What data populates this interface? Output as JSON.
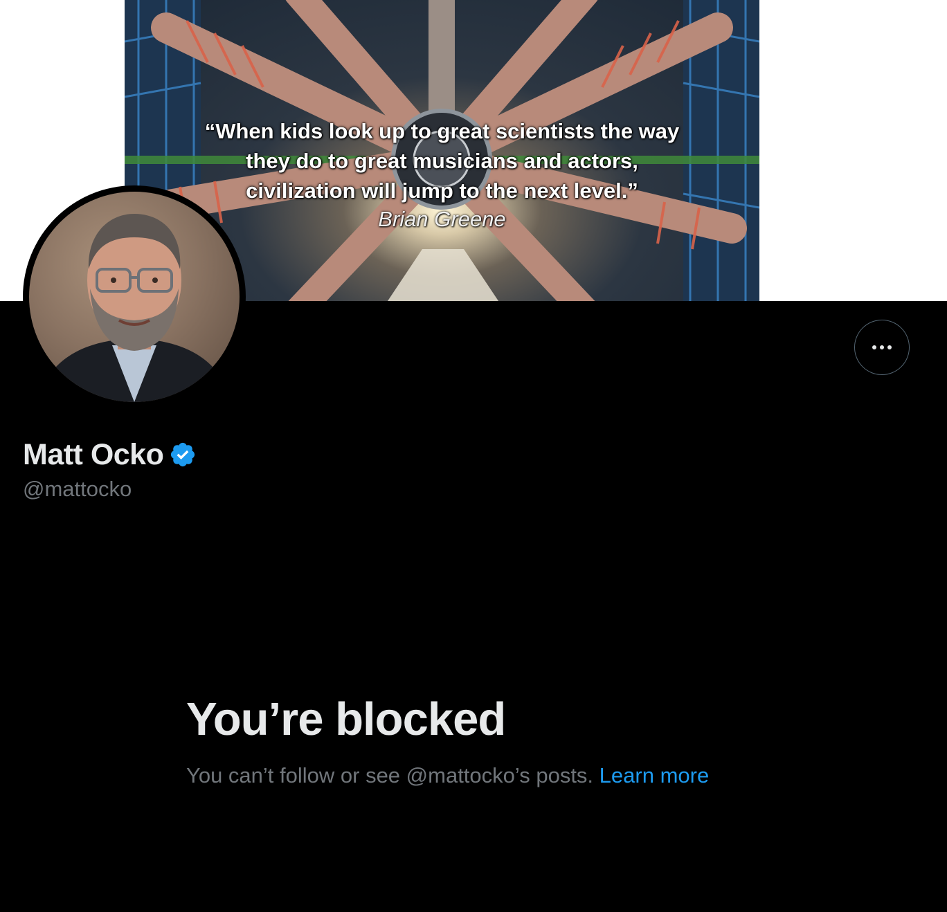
{
  "banner": {
    "quote": "“When kids look up to great scientists the way they do to great musicians and actors, civilization will jump to the next level.”",
    "quote_line1": "“When kids look up to great scientists the way",
    "quote_line2": "they do to great musicians and actors,",
    "quote_line3": "civilization will jump to the next level.”",
    "attribution": "Brian Greene"
  },
  "profile": {
    "display_name": "Matt Ocko",
    "handle": "@mattocko",
    "verified": true,
    "verified_icon": "verified-badge-icon",
    "more_icon": "more-options-icon"
  },
  "blocked": {
    "title": "You’re blocked",
    "description": "You can’t follow or see @mattocko’s posts.",
    "learn_more": "Learn more"
  },
  "colors": {
    "background": "#000000",
    "primary_text": "#e7e9ea",
    "secondary_text": "#71767b",
    "accent": "#1d9bf0",
    "border": "#536471"
  }
}
